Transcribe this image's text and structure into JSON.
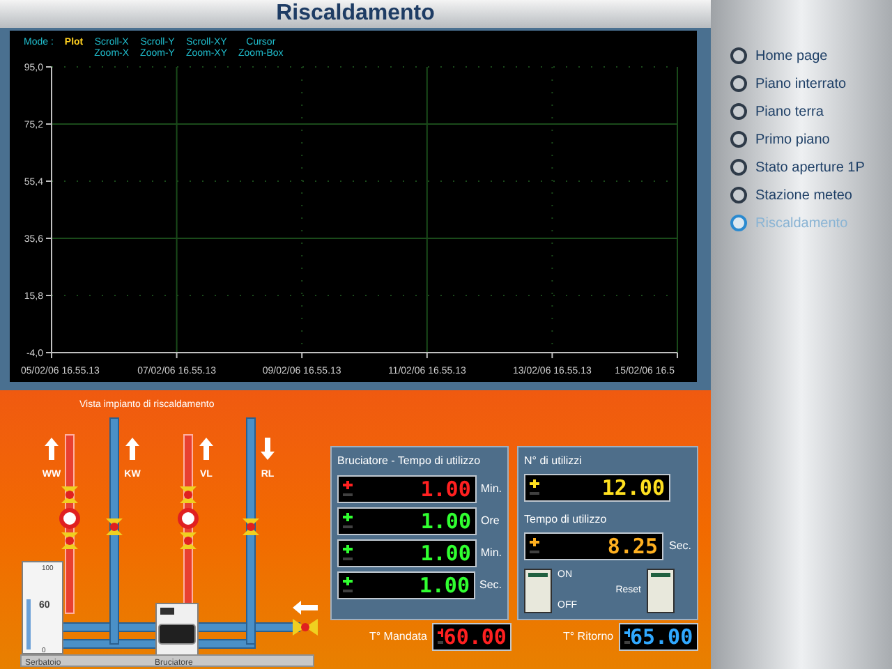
{
  "window": {
    "title": "Riscaldamento"
  },
  "mode_bar": {
    "label": "Mode :",
    "options": [
      {
        "lines": [
          "Plot"
        ],
        "selected": true
      },
      {
        "lines": [
          "Scroll-X",
          "Zoom-X"
        ],
        "selected": false
      },
      {
        "lines": [
          "Scroll-Y",
          "Zoom-Y"
        ],
        "selected": false
      },
      {
        "lines": [
          "Scroll-XY",
          "Zoom-XY"
        ],
        "selected": false
      },
      {
        "lines": [
          "Cursor",
          "Zoom-Box"
        ],
        "selected": false
      }
    ]
  },
  "chart": {
    "chart_data": {
      "type": "line",
      "grid": true,
      "ylim": [
        -4.0,
        95.0
      ],
      "yticks": [
        {
          "value": 95.0,
          "label": "95,0"
        },
        {
          "value": 75.2,
          "label": "75,2"
        },
        {
          "value": 55.4,
          "label": "55,4"
        },
        {
          "value": 35.6,
          "label": "35,6"
        },
        {
          "value": 15.8,
          "label": "15,8"
        },
        {
          "value": -4.0,
          "label": "-4,0"
        }
      ],
      "categories": [
        "05/02/06 16.55.13",
        "07/02/06 16.55.13",
        "09/02/06 16.55.13",
        "11/02/06 16.55.13",
        "13/02/06 16.55.13",
        "15/02/06 16.5"
      ],
      "values": [
        null,
        null,
        null,
        null,
        null,
        null
      ]
    }
  },
  "nav": {
    "items": [
      {
        "label": "Home page",
        "selected": false
      },
      {
        "label": "Piano interrato",
        "selected": false
      },
      {
        "label": "Piano terra",
        "selected": false
      },
      {
        "label": "Primo piano",
        "selected": false
      },
      {
        "label": "Stato aperture 1P",
        "selected": false
      },
      {
        "label": "Stazione meteo",
        "selected": false
      },
      {
        "label": "Riscaldamento",
        "selected": true
      }
    ]
  },
  "plant": {
    "title": "Vista impianto di riscaldamento",
    "lines": [
      {
        "label": "WW",
        "kind": "up"
      },
      {
        "label": "KW",
        "kind": "up"
      },
      {
        "label": "VL",
        "kind": "up"
      },
      {
        "label": "RL",
        "kind": "down"
      }
    ],
    "tank": {
      "label": "Serbatoio",
      "scale": [
        "100",
        "60",
        "0"
      ],
      "level": 0.6
    },
    "burner": {
      "label": "Bruciatore"
    }
  },
  "burner_panel": {
    "title": "Bruciatore - Tempo di utilizzo",
    "displays": [
      {
        "value": "1.00",
        "unit": "Min.",
        "color": "#ff2020"
      },
      {
        "value": "1.00",
        "unit": "Ore",
        "color": "#30ff30"
      },
      {
        "value": "1.00",
        "unit": "Min.",
        "color": "#30ff30"
      },
      {
        "value": "1.00",
        "unit": "Sec.",
        "color": "#30ff30"
      }
    ]
  },
  "usage_panel": {
    "count_label": "N° di utilizzi",
    "count": {
      "value": "12.00",
      "color": "#ffe020"
    },
    "time_label": "Tempo di utilizzo",
    "time": {
      "value": "8.25",
      "unit": "Sec.",
      "color": "#ffb020"
    },
    "switch": {
      "on_label": "ON",
      "off_label": "OFF",
      "on": true
    },
    "reset_label": "Reset"
  },
  "temperatures": [
    {
      "label": "T° Mandata",
      "value": "60.00",
      "color": "#ff2020"
    },
    {
      "label": "T° Ritorno",
      "value": "65.00",
      "color": "#30a8ff"
    }
  ]
}
